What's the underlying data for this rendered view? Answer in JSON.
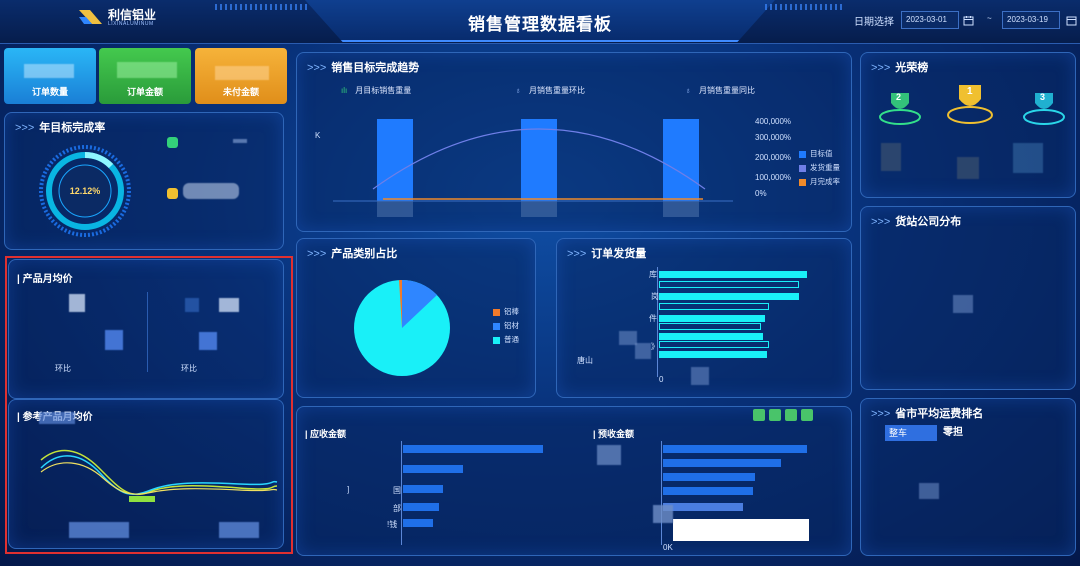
{
  "header": {
    "logo_cn": "利信铝业",
    "logo_en": "LIXINALUMINUM",
    "title": "销售管理数据看板",
    "date_label": "日期选择",
    "date_start": "2023-03-01",
    "date_sep": "~",
    "date_end": "2023-03-19"
  },
  "kpis": [
    {
      "label": "订单数量",
      "color": "#2aa5ee"
    },
    {
      "label": "订单金额",
      "color": "#3ab54a"
    },
    {
      "label": "未付金额",
      "color": "#f0a526"
    }
  ],
  "annual": {
    "title": "年目标完成率",
    "rate": "12.12%"
  },
  "product_price": {
    "title": "| 产品月均价",
    "huanbi1": "环比",
    "huanbi2": "环比"
  },
  "ref_price": {
    "title": "| 参考产品月均价"
  },
  "trend": {
    "title": "销售目标完成趋势",
    "tabs": [
      "月目标销售重量",
      "月销售重量环比",
      "月销售重量同比"
    ],
    "y_left_tick": "K",
    "y_right_ticks": [
      "400,000%",
      "300,000%",
      "200,000%",
      "100,000%",
      "0%"
    ],
    "legend": [
      "目标值",
      "发货重量",
      "月完成率"
    ],
    "legend_colors": [
      "#1f7bff",
      "#6f7fe8",
      "#f08a2a"
    ]
  },
  "category": {
    "title": "产品类别占比",
    "legend": [
      "铝棒",
      "铝材",
      "普通"
    ],
    "legend_colors": [
      "#f07a2a",
      "#2f86ff",
      "#19f0f8"
    ]
  },
  "shipment": {
    "title": "订单发货量",
    "axis_zero": "0",
    "label_ku": "库",
    "label_gang": "岗",
    "label_jian": "件",
    "label_ru": "》",
    "label_tangshan": "唐山"
  },
  "ar": {
    "title": "| 应收金额",
    "labels": [
      "]",
      "国",
      "部",
      "!钱"
    ]
  },
  "pr": {
    "title": "| 预收金额",
    "axis": "0K",
    "axis_end": "0K"
  },
  "honor": {
    "title": "光荣榜",
    "ranks": [
      "2",
      "1",
      "3"
    ]
  },
  "freight": {
    "title": "货站公司分布"
  },
  "province": {
    "title": "省市平均运费排名",
    "tab_active": "整车",
    "tab_inactive": "零担"
  }
}
